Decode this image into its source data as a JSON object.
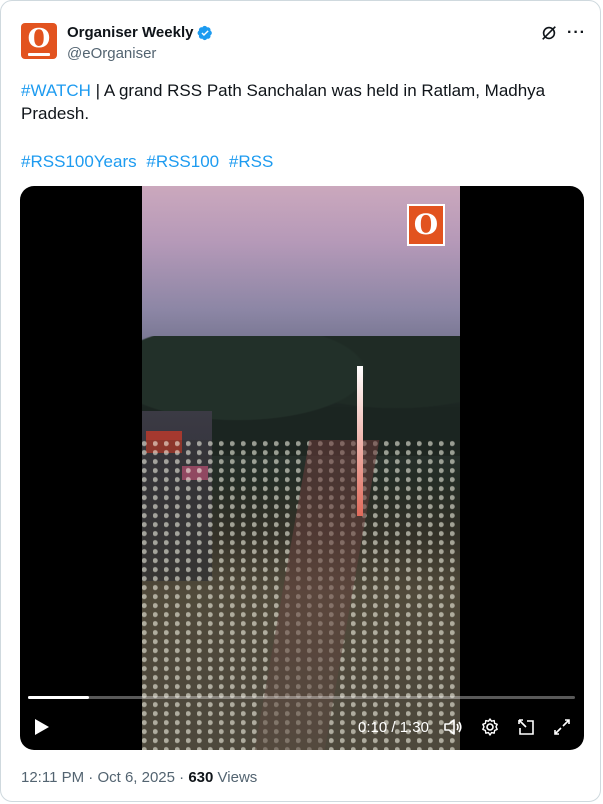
{
  "author": {
    "display_name": "Organiser Weekly",
    "handle": "@eOrganiser",
    "avatar_letter": "O",
    "brand_color": "#e2531f",
    "verified_color": "#1d9bf0"
  },
  "tweet": {
    "hashtag_watch": "#WATCH",
    "separator": " | ",
    "text": "A grand RSS Path Sanchalan was held in Ratlam, Madhya Pradesh.",
    "hashtags": [
      "#RSS100Years",
      "#RSS100",
      "#RSS"
    ]
  },
  "video": {
    "watermark_letter": "O",
    "current_time": "0:10",
    "time_separator": " / ",
    "duration": "1:30",
    "progress_fraction": 0.111
  },
  "meta": {
    "time": "12:11 PM",
    "dot1": " · ",
    "date": "Oct 6, 2025",
    "dot2": " · ",
    "views_count": "630",
    "views_label": " Views"
  },
  "icons": {
    "grok": "grok-icon",
    "more": "more-icon",
    "play": "play-icon",
    "volume": "volume-icon",
    "settings": "settings-icon",
    "pip": "picture-in-picture-icon",
    "fullscreen": "fullscreen-icon"
  }
}
